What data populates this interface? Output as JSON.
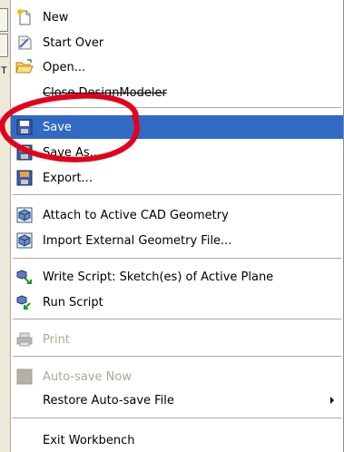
{
  "background": {
    "strip_letter": "T"
  },
  "menu": {
    "items": [
      {
        "label": "New",
        "icon": "new-document-icon",
        "enabled": true
      },
      {
        "label": "Start Over",
        "icon": "start-over-icon",
        "enabled": true
      },
      {
        "label": "Open...",
        "icon": "open-folder-icon",
        "enabled": true
      },
      {
        "label": "Close DesignModeler",
        "icon": "",
        "enabled": true,
        "struck": true
      },
      {
        "label": "Save",
        "icon": "save-disk-icon",
        "enabled": true,
        "selected": true
      },
      {
        "label": "Save As...",
        "icon": "save-as-icon",
        "enabled": true
      },
      {
        "label": "Export...",
        "icon": "export-icon",
        "enabled": true
      },
      {
        "label": "Attach to Active CAD Geometry",
        "icon": "attach-cad-icon",
        "enabled": true
      },
      {
        "label": "Import External Geometry File...",
        "icon": "import-geometry-icon",
        "enabled": true
      },
      {
        "label": "Write Script: Sketch(es) of Active Plane",
        "icon": "write-script-icon",
        "enabled": true
      },
      {
        "label": "Run Script",
        "icon": "run-script-icon",
        "enabled": true
      },
      {
        "label": "Print",
        "icon": "print-icon",
        "enabled": false
      },
      {
        "label": "Auto-save Now",
        "icon": "auto-save-icon",
        "enabled": false
      },
      {
        "label": "Restore Auto-save File",
        "icon": "",
        "enabled": true,
        "submenu": true
      },
      {
        "label": "Exit Workbench",
        "icon": "",
        "enabled": true
      }
    ]
  },
  "colors": {
    "selection": "#316ac5",
    "annotation": "#e3001b",
    "disabled_text": "#aca899"
  }
}
